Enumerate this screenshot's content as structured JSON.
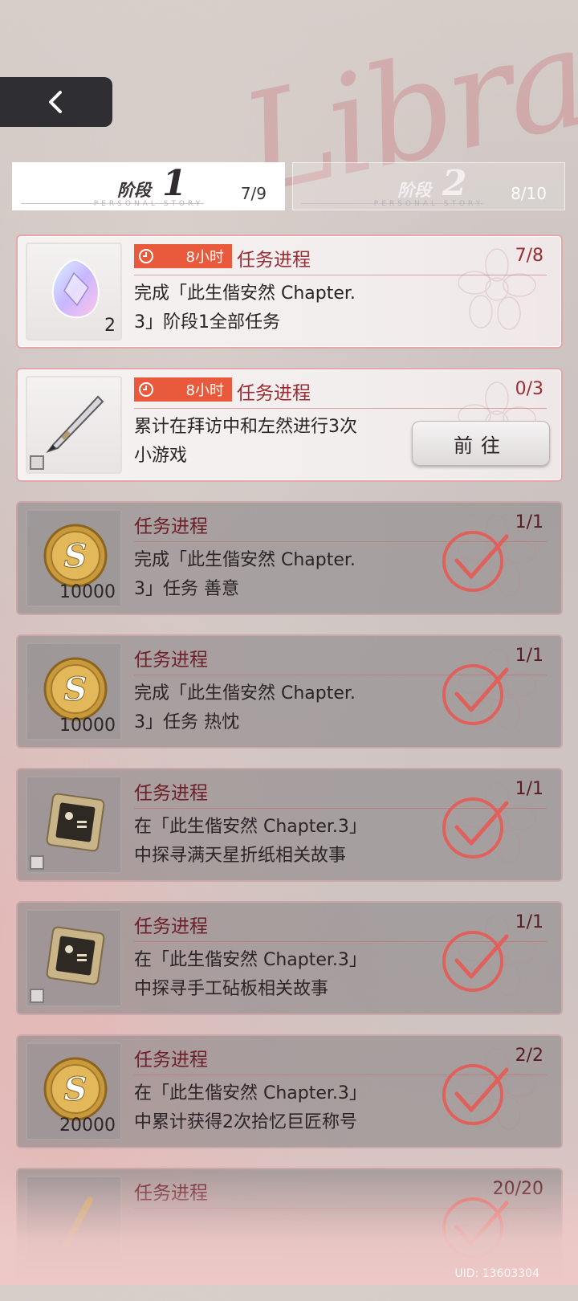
{
  "background_script": "Libra",
  "nav": {
    "back_icon": "chevron-left-icon"
  },
  "tabs": [
    {
      "word": "阶段",
      "num": "1",
      "sub": "PERSONAL STORY",
      "count": "7/9",
      "active": true
    },
    {
      "word": "阶段",
      "num": "2",
      "sub": "PERSONAL STORY",
      "count": "8/10",
      "active": false
    }
  ],
  "tasks": [
    {
      "item_icon": "crystal-icon",
      "qty": "2",
      "timer": "8小时",
      "label": "任务进程",
      "progress": "7/8",
      "desc": "完成「此生偕安然 Chapter.\n3」阶段1全部任务",
      "state": "pending"
    },
    {
      "item_icon": "pen-icon",
      "qty": "",
      "timer": "8小时",
      "label": "任务进程",
      "progress": "0/3",
      "desc": "累计在拜访中和左然进行3次\n小游戏",
      "state": "go",
      "go_label": "前往"
    },
    {
      "item_icon": "coin-icon",
      "qty": "10000",
      "timer": "",
      "label": "任务进程",
      "progress": "1/1",
      "desc": "完成「此生偕安然 Chapter.\n3」任务 善意",
      "state": "done"
    },
    {
      "item_icon": "coin-icon",
      "qty": "10000",
      "timer": "",
      "label": "任务进程",
      "progress": "1/1",
      "desc": "完成「此生偕安然 Chapter.\n3」任务 热忱",
      "state": "done"
    },
    {
      "item_icon": "chip-card-icon",
      "qty": "",
      "timer": "",
      "label": "任务进程",
      "progress": "1/1",
      "desc": "在「此生偕安然 Chapter.3」\n中探寻满天星折纸相关故事",
      "state": "done"
    },
    {
      "item_icon": "chip-card-icon",
      "qty": "",
      "timer": "",
      "label": "任务进程",
      "progress": "1/1",
      "desc": "在「此生偕安然 Chapter.3」\n中探寻手工砧板相关故事",
      "state": "done"
    },
    {
      "item_icon": "coin-icon",
      "qty": "20000",
      "timer": "",
      "label": "任务进程",
      "progress": "2/2",
      "desc": "在「此生偕安然 Chapter.3」\n中累计获得2次拾忆巨匠称号",
      "state": "done"
    },
    {
      "item_icon": "scroll-icon",
      "qty": "",
      "timer": "",
      "label": "任务进程",
      "progress": "20/20",
      "desc": "",
      "state": "done"
    }
  ],
  "uid": "UID: 13603304",
  "colors": {
    "accent": "#e95a3d",
    "label_red": "#9a2c34",
    "border_pink": "#e5a7aa"
  }
}
